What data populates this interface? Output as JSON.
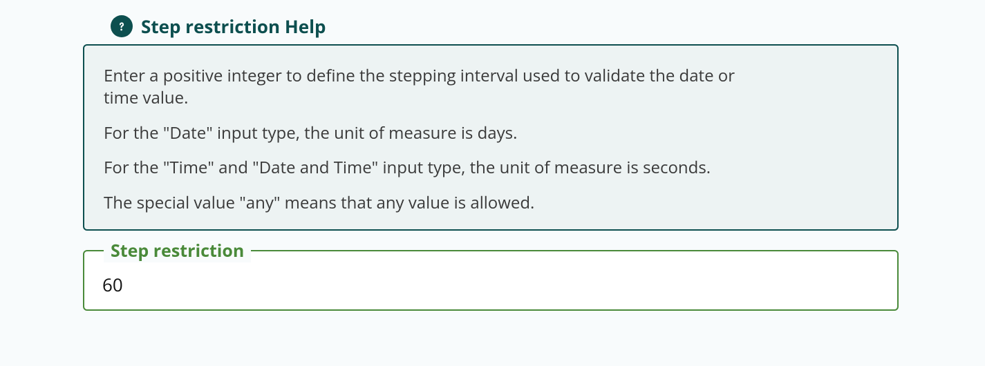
{
  "help": {
    "title": "Step restriction Help",
    "paragraphs": [
      "Enter a positive integer to define the stepping interval used to validate the date or time value.",
      "For the \"Date\" input type, the unit of measure is days.",
      "For the \"Time\" and \"Date and Time\" input type, the unit of measure is seconds.",
      "The special value \"any\" means that any value is allowed."
    ]
  },
  "field": {
    "label": "Step restriction",
    "value": "60"
  }
}
